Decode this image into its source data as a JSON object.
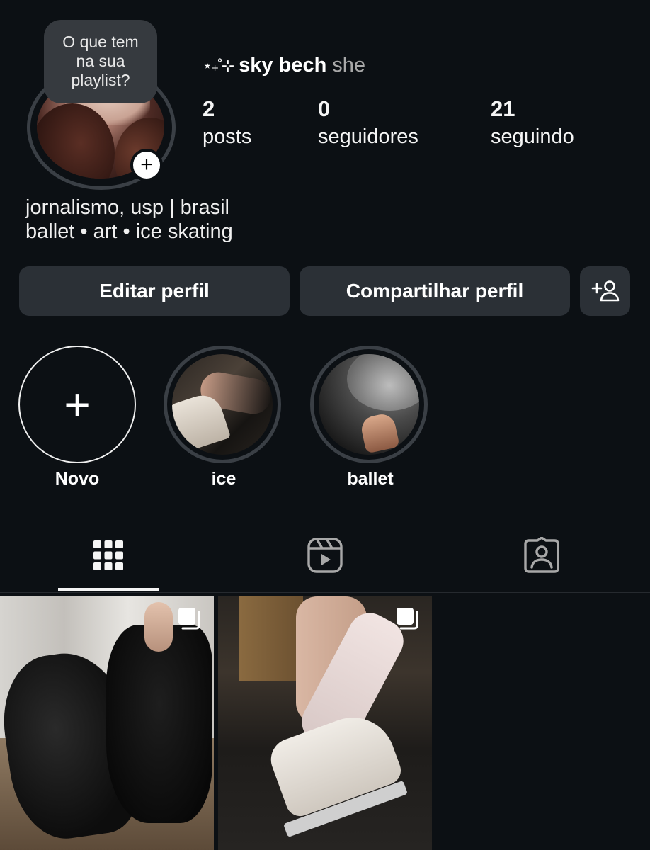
{
  "profile": {
    "note": [
      "O que tem",
      "na sua",
      "playlist?"
    ],
    "name_decoration": "⋆₊˚⊹",
    "username": "sky bech",
    "pronouns": "she",
    "stats": {
      "posts": {
        "value": "2",
        "label": "posts"
      },
      "followers": {
        "value": "0",
        "label": "seguidores"
      },
      "following": {
        "value": "21",
        "label": "seguindo"
      }
    },
    "bio": [
      "jornalismo, usp | brasil",
      "ballet • art • ice skating"
    ]
  },
  "buttons": {
    "edit": "Editar perfil",
    "share": "Compartilhar perfil",
    "add_badge": "+"
  },
  "highlights": [
    {
      "label": "Novo",
      "icon": "plus-icon"
    },
    {
      "label": "ice"
    },
    {
      "label": "ballet"
    }
  ],
  "tabs": [
    {
      "name": "posts",
      "icon": "grid-icon",
      "active": true
    },
    {
      "name": "reels",
      "icon": "reels-icon",
      "active": false
    },
    {
      "name": "tagged",
      "icon": "tagged-icon",
      "active": false
    }
  ],
  "colors": {
    "background": "#0c1014",
    "button": "#2b3036",
    "ring": "#3a3f45",
    "text": "#f5f5f5",
    "muted": "#a8a8a8"
  }
}
